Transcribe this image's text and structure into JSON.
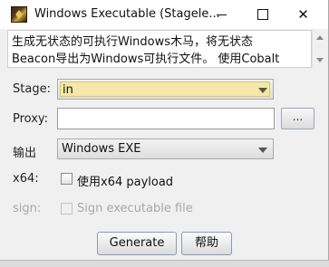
{
  "window": {
    "title": "Windows Executable (Stagele...",
    "minimize_label": "",
    "close_label": "✕"
  },
  "description": {
    "line1": "生成无状态的可执行Windows木马，将无状态",
    "line2": "Beacon导出为Windows可执行文件。 使用Cobalt"
  },
  "form": {
    "stage_label": "Stage:",
    "stage_value": "in",
    "proxy_label": "Proxy:",
    "proxy_value": "",
    "browse_label": "...",
    "output_label": "输出",
    "output_value": "Windows EXE",
    "x64_label": "x64:",
    "x64_checkbox_label": "使用x64 payload",
    "x64_checked": false,
    "sign_label": "sign:",
    "sign_checkbox_label": "Sign executable file",
    "sign_checked": false,
    "sign_enabled": false
  },
  "buttons": {
    "generate": "Generate",
    "help": "帮助"
  }
}
